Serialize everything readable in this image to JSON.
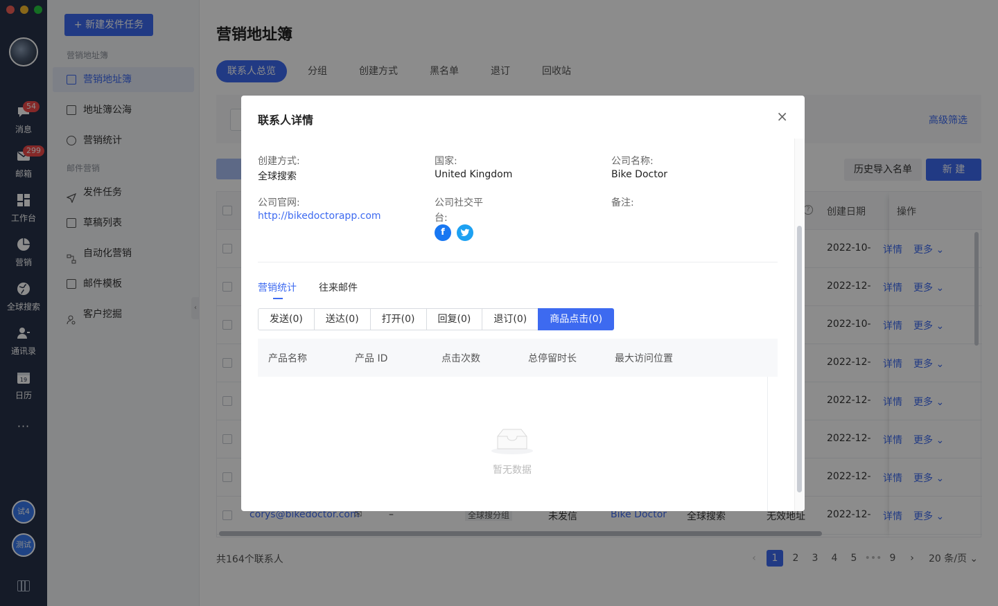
{
  "rail": {
    "items": [
      {
        "label": "消息",
        "badge": "54"
      },
      {
        "label": "邮箱",
        "badge": "299"
      },
      {
        "label": "工作台"
      },
      {
        "label": "营销"
      },
      {
        "label": "全球搜索"
      },
      {
        "label": "通讯录"
      },
      {
        "label": "日历"
      }
    ],
    "more": "···",
    "users": [
      "试4",
      "测试"
    ]
  },
  "sidebar": {
    "new_task": "+ 新建发件任务",
    "section1": "营销地址簿",
    "items1": [
      "营销地址簿",
      "地址簿公海",
      "营销统计"
    ],
    "section2": "邮件营销",
    "items2": [
      "发件任务",
      "草稿列表",
      "自动化营销",
      "邮件模板",
      "客户挖掘"
    ]
  },
  "main": {
    "title": "营销地址簿",
    "tabs": [
      "联系人总览",
      "分组",
      "创建方式",
      "黑名单",
      "退订",
      "回收站"
    ],
    "adv_filter": "高级筛选",
    "import_btn": "历史导入名单",
    "new_btn": "新 建",
    "columns": {
      "created": "创建日期",
      "ops": "操作"
    },
    "rows": [
      {
        "date": "2022-10-",
        "detail": "详情",
        "more": "更多"
      },
      {
        "date": "2022-12-",
        "detail": "详情",
        "more": "更多"
      },
      {
        "date": "2022-10-",
        "detail": "详情",
        "more": "更多"
      },
      {
        "date": "2022-12-",
        "detail": "详情",
        "more": "更多"
      },
      {
        "date": "2022-12-",
        "detail": "详情",
        "more": "更多"
      },
      {
        "date": "2022-12-",
        "detail": "详情",
        "more": "更多"
      },
      {
        "date": "2022-12-",
        "detail": "详情",
        "more": "更多"
      }
    ],
    "last_row": {
      "email": "corys@bikedoctor.com",
      "dash": "–",
      "group": "全球搜分组",
      "status": "未发信",
      "company": "Bike Doctor",
      "source": "全球搜索",
      "validity": "无效地址",
      "date": "2022-12-",
      "detail": "详情",
      "more": "更多"
    },
    "total": "共164个联系人",
    "pager": {
      "pages": [
        "1",
        "2",
        "3",
        "4",
        "5",
        "•••",
        "9"
      ],
      "page_size": "20 条/页"
    }
  },
  "modal": {
    "title": "联系人详情",
    "fields": {
      "create_method_label": "创建方式:",
      "create_method": "全球搜索",
      "country_label": "国家:",
      "country": "United Kingdom",
      "company_label": "公司名称:",
      "company": "Bike Doctor",
      "website_label": "公司官网:",
      "website": "http://bikedoctorapp.com",
      "social_label_1": "公司社交平",
      "social_label_2": "台:",
      "note_label": "备注:"
    },
    "tabs": [
      "营销统计",
      "往来邮件"
    ],
    "segments": [
      "发送(0)",
      "送达(0)",
      "打开(0)",
      "回复(0)",
      "退订(0)",
      "商品点击(0)"
    ],
    "table_headers": [
      "产品名称",
      "产品 ID",
      "点击次数",
      "总停留时长",
      "最大访问位置"
    ],
    "empty": "暂无数据"
  }
}
